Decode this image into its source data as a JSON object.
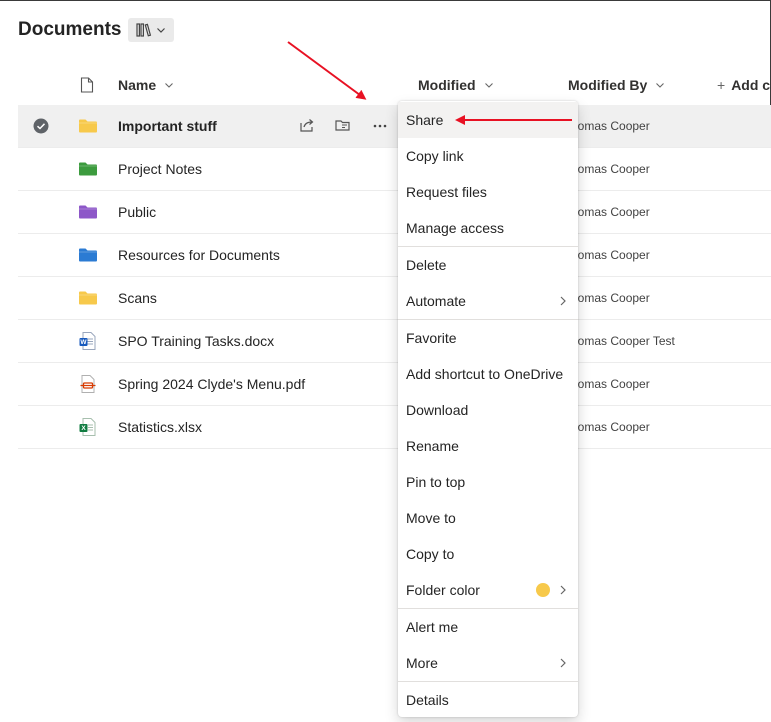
{
  "header": {
    "title": "Documents",
    "view_icon": "library-icon"
  },
  "columns": {
    "name": "Name",
    "modified": "Modified",
    "modified_by": "Modified By",
    "add_column": "Add c"
  },
  "rows": [
    {
      "name": "Important stuff",
      "type": "folder",
      "color": "#f7c94b",
      "modified_by": "homas Cooper",
      "selected": true
    },
    {
      "name": "Project Notes",
      "type": "folder",
      "color": "#3c9b3e",
      "modified_by": "homas Cooper",
      "selected": false
    },
    {
      "name": "Public",
      "type": "folder",
      "color": "#8d57c8",
      "modified_by": "homas Cooper",
      "selected": false
    },
    {
      "name": "Resources for Documents",
      "type": "folder",
      "color": "#2b7bd3",
      "modified_by": "homas Cooper",
      "selected": false
    },
    {
      "name": "Scans",
      "type": "folder",
      "color": "#f7c94b",
      "modified_by": "homas Cooper",
      "selected": false
    },
    {
      "name": "SPO Training Tasks.docx",
      "type": "word",
      "color": "#185abd",
      "modified_by": "homas Cooper Test",
      "selected": false
    },
    {
      "name": "Spring 2024 Clyde's Menu.pdf",
      "type": "pdf",
      "color": "#d83b01",
      "modified_by": "homas Cooper",
      "selected": false
    },
    {
      "name": "Statistics.xlsx",
      "type": "excel",
      "color": "#107c41",
      "modified_by": "homas Cooper",
      "selected": false
    }
  ],
  "row_actions": [
    "share-icon",
    "open-folder-icon",
    "more-icon"
  ],
  "context_menu": {
    "items": [
      "Share",
      "Copy link",
      "Request files",
      "Manage access",
      "Delete",
      "Automate",
      "Favorite",
      "Add shortcut to OneDrive",
      "Download",
      "Rename",
      "Pin to top",
      "Move to",
      "Copy to",
      "Folder color",
      "Alert me",
      "More",
      "Details"
    ],
    "highlighted": "Share",
    "folder_color_swatch": "#f7c94b"
  },
  "annotations": {
    "arrow_color": "#e81123"
  }
}
